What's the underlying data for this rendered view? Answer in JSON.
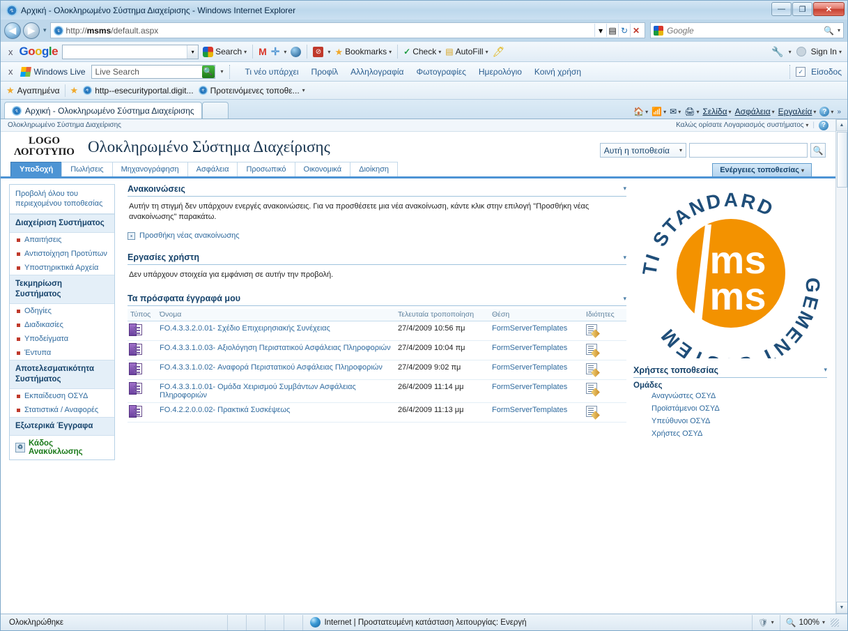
{
  "window": {
    "title": "Αρχική - Ολοκληρωμένο Σύστημα Διαχείρισης - Windows Internet Explorer",
    "minimize_label": "—",
    "maximize_label": "❐",
    "close_label": "✕"
  },
  "address": {
    "back_label": "◀",
    "forward_label": "▶",
    "history_caret": "▾",
    "url_prefix": "http://",
    "url_host": "msms",
    "url_path": "/default.aspx",
    "dropdown_caret": "▾",
    "compat_icon": "compatibility-view-icon",
    "refresh_label": "↻",
    "stop_label": "✕",
    "search_placeholder": "Google",
    "search_caret": "▾"
  },
  "google_toolbar": {
    "close_label": "x",
    "logo": "Google",
    "query": "",
    "search_label": "Search",
    "caret": "▾",
    "gmail_icon": "gmail-icon",
    "plus_icon": "plus-icon",
    "translate_icon": "translate-icon",
    "blocked_icon": "popup-blocker-icon",
    "bookmarks_label": "Bookmarks",
    "check_label": "Check",
    "autofill_label": "AutoFill",
    "highlight_icon": "highlighter-icon",
    "settings_icon": "wrench-icon",
    "signin_label": "Sign In"
  },
  "live_toolbar": {
    "close_label": "x",
    "brand": "Windows Live",
    "search_value": "Live Search",
    "search_icon": "search-icon",
    "caret": "▾",
    "links": [
      "Τι νέο υπάρχει",
      "Προφίλ",
      "Αλληλογραφία",
      "Φωτογραφίες",
      "Ημερολόγιο",
      "Κοινή χρήση"
    ],
    "login_label": "Είσοδος"
  },
  "favorites_bar": {
    "favorites_label": "Αγαπημένα",
    "items": [
      {
        "label": "http--esecurityportal.digit...",
        "icon": "page-icon"
      },
      {
        "label": "Προτεινόμενες τοποθε...",
        "icon": "ie-icon"
      }
    ],
    "overflow_caret": "▾"
  },
  "browser_tabs": {
    "tabs": [
      {
        "label": "Αρχική - Ολοκληρωμένο Σύστημα Διαχείρισης",
        "active": true
      }
    ],
    "new_tab_label": ""
  },
  "ie_commands": {
    "home_label": "home-icon",
    "feeds_label": "feeds-icon",
    "mail_label": "mail-icon",
    "print_label": "print-icon",
    "page_label": "Σελίδα",
    "safety_label": "Ασφάλεια",
    "tools_label": "Εργαλεία",
    "help_label": "?",
    "overflow_label": "»"
  },
  "sharepoint": {
    "breadcrumb": "Ολοκληρωμένο Σύστημα Διαχείρισης",
    "welcome": "Καλώς ορίσατε Λογαριασμός συστήματος",
    "welcome_caret": "▾",
    "help_label": "?",
    "logo_line1": "LOGO",
    "logo_line2": "ΛΟΓΟΤΥΠΟ",
    "site_title": "Ολοκληρωμένο Σύστημα Διαχείρισης",
    "search_scope": "Αυτή η τοποθεσία",
    "search_scope_caret": "▾",
    "search_value": "",
    "search_go_icon": "search-icon",
    "site_actions": "Ενέργειες τοποθεσίας",
    "site_actions_caret": "▾",
    "tabs": [
      {
        "label": "Υποδοχή",
        "active": true
      },
      {
        "label": "Πωλήσεις",
        "active": false
      },
      {
        "label": "Μηχανογράφηση",
        "active": false
      },
      {
        "label": "Ασφάλεια",
        "active": false
      },
      {
        "label": "Προσωπικό",
        "active": false
      },
      {
        "label": "Οικονομικά",
        "active": false
      },
      {
        "label": "Διοίκηση",
        "active": false
      }
    ]
  },
  "quicklaunch": {
    "view_all": "Προβολή όλου του περιεχομένου τοποθεσίας",
    "sections": [
      {
        "heading": "Διαχείριση Συστήματος",
        "links": [
          "Απαιτήσεις",
          "Αντιστοίχηση Προτύπων",
          "Υποστηρικτικά Αρχεία"
        ]
      },
      {
        "heading": "Τεκμηρίωση Συστήματος",
        "links": [
          "Οδηγίες",
          "Διαδικασίες",
          "Υποδείγματα",
          "Έντυπα"
        ]
      },
      {
        "heading": "Αποτελεσματικότητα Συστήματος",
        "links": [
          "Εκπαίδευση ΟΣΥΔ",
          "Στατιστικά / Αναφορές"
        ]
      },
      {
        "heading": "Εξωτερικά Έγγραφα",
        "links": []
      }
    ],
    "recycle_bin": "Κάδος Ανακύκλωσης"
  },
  "webparts": {
    "announcements": {
      "title": "Ανακοινώσεις",
      "menu_caret": "▾",
      "empty_text": "Αυτήν τη στιγμή δεν υπάρχουν ενεργές ανακοινώσεις. Για να προσθέσετε μια νέα ανακοίνωση, κάντε κλικ στην επιλογή \"Προσθήκη νέας ανακοίνωσης\" παρακάτω.",
      "add_link": "Προσθήκη νέας ανακοίνωσης",
      "add_icon": "add-item-icon"
    },
    "user_tasks": {
      "title": "Εργασίες χρήστη",
      "menu_caret": "▾",
      "empty_text": "Δεν υπάρχουν στοιχεία για εμφάνιση σε αυτήν την προβολή."
    },
    "recent_docs": {
      "title": "Τα πρόσφατα έγγραφά μου",
      "menu_caret": "▾",
      "columns": [
        "Τύπος",
        "Όνομα",
        "Τελευταία τροποποίηση",
        "Θέση",
        "Ιδιότητες"
      ],
      "rows": [
        {
          "type_icon": "infopath-form-icon",
          "name": "FO.4.3.3.2.0.01- Σχέδιο Επιχειρησιακής Συνέχειας",
          "modified": "27/4/2009 10:56 πμ",
          "location": "FormServerTemplates",
          "props_icon": "edit-properties-icon"
        },
        {
          "type_icon": "infopath-form-icon",
          "name": "FO.4.3.3.1.0.03- Αξιολόγηση Περιστατικού Ασφάλειας Πληροφοριών",
          "modified": "27/4/2009 10:04 πμ",
          "location": "FormServerTemplates",
          "props_icon": "edit-properties-icon"
        },
        {
          "type_icon": "infopath-form-icon",
          "name": "FO.4.3.3.1.0.02- Αναφορά Περιστατικού Ασφάλειας Πληροφοριών",
          "modified": "27/4/2009 9:02 πμ",
          "location": "FormServerTemplates",
          "props_icon": "edit-properties-icon"
        },
        {
          "type_icon": "infopath-form-icon",
          "name": "FO.4.3.3.1.0.01- Ομάδα Χειρισμού Συμβάντων Ασφάλειας Πληροφοριών",
          "modified": "26/4/2009 11:14 μμ",
          "location": "FormServerTemplates",
          "props_icon": "edit-properties-icon"
        },
        {
          "type_icon": "infopath-form-icon",
          "name": "FO.4.2.2.0.0.02- Πρακτικά Συσκέψεως",
          "modified": "26/4/2009 11:13 μμ",
          "location": "FormServerTemplates",
          "props_icon": "edit-properties-icon"
        }
      ]
    },
    "site_users": {
      "title": "Χρήστες τοποθεσίας",
      "menu_caret": "▾",
      "groups_heading": "Ομάδες",
      "groups": [
        "Αναγνώστες ΟΣΥΔ",
        "Προϊστάμενοι ΟΣΥΔ",
        "Υπεύθυνοι ΟΣΥΔ",
        "Χρήστες ΟΣΥΔ"
      ]
    }
  },
  "logo": {
    "outer_text_top": "MULTI STANDARD",
    "outer_text_bottom": "MANAGEMENT SYSTEM",
    "inner_text": "ms ms",
    "circle_color": "#F39200",
    "text_color": "#1F4E79"
  },
  "statusbar": {
    "status_text": "Ολοκληρώθηκε",
    "zone_text": "Internet | Προστατευμένη κατάσταση λειτουργίας: Ενεργή",
    "zone_icon": "internet-zone-icon",
    "protected_caret": "▾",
    "zoom_level": "100%",
    "zoom_caret": "▾"
  },
  "scrollbar": {
    "up_label": "▲",
    "down_label": "▼"
  }
}
